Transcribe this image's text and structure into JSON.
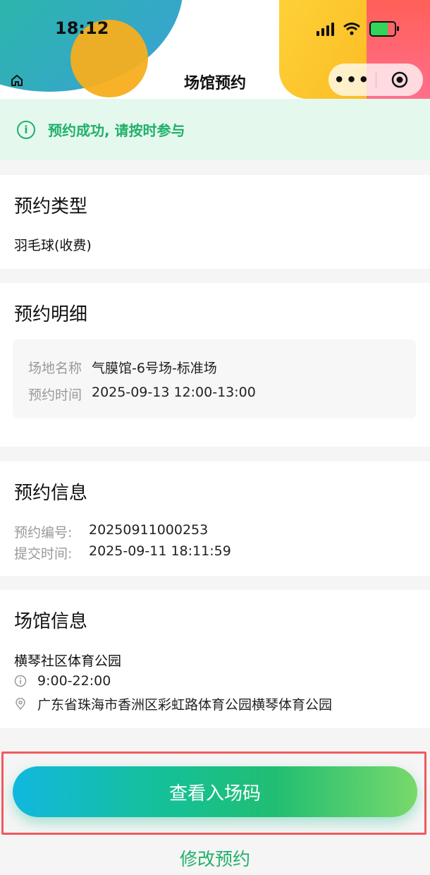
{
  "status_bar": {
    "time": "18:12"
  },
  "nav": {
    "title": "场馆预约",
    "more": "•••"
  },
  "banner": {
    "text": "预约成功, 请按时参与"
  },
  "booking_type": {
    "title": "预约类型",
    "value": "羽毛球(收费)"
  },
  "booking_detail": {
    "title": "预约明细",
    "rows": [
      {
        "label": "场地名称",
        "value": "气膜馆-6号场-标准场"
      },
      {
        "label": "预约时间",
        "value": "2025-09-13 12:00-13:00"
      }
    ]
  },
  "booking_info": {
    "title": "预约信息",
    "rows": [
      {
        "label": "预约编号:",
        "value": "20250911000253"
      },
      {
        "label": "提交时间:",
        "value": "2025-09-11 18:11:59"
      }
    ]
  },
  "venue_info": {
    "title": "场馆信息",
    "name": "横琴社区体育公园",
    "hours": "9:00-22:00",
    "address": "广东省珠海市香洲区彩虹路体育公园横琴体育公园"
  },
  "actions": {
    "view_code": "查看入场码",
    "modify": "修改预约"
  },
  "colors": {
    "accent_green": "#20b06a",
    "success_bg": "#e5f8ee",
    "highlight_red": "#f05a5f"
  }
}
